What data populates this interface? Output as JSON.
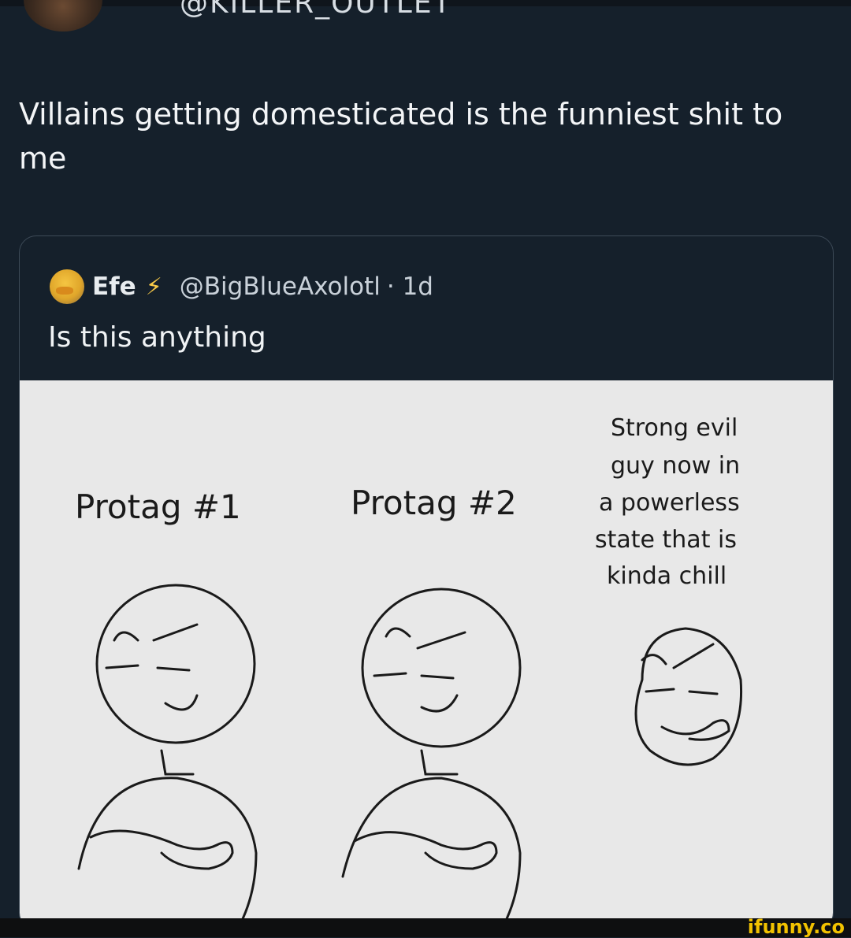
{
  "header": {
    "handle": "@KILLER_OUTLET"
  },
  "tweet": {
    "text": "Villains getting domesticated is the funniest shit to me"
  },
  "quote": {
    "name": "Efe",
    "badge_icon": "lightning-bolt-icon",
    "handle": "@BigBlueAxolotl",
    "time": "· 1d",
    "text": "Is this anything"
  },
  "comic": {
    "label_1": "Protag #1",
    "label_2": "Protag #2",
    "label_3_lines": [
      "Strong evil",
      "guy now in",
      "a powerless",
      "state that is",
      "kinda chill"
    ]
  },
  "watermark": "ifunny.co",
  "colors": {
    "background": "#15202b",
    "border": "#3d4a57",
    "bolt": "#f7c948",
    "watermark": "#f2c200"
  }
}
